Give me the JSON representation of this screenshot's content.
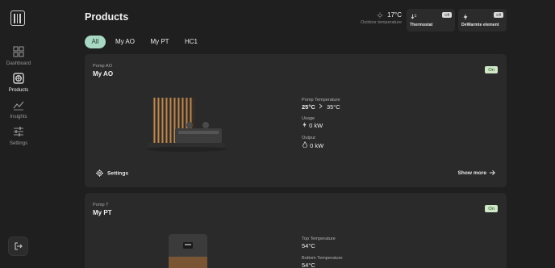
{
  "sidebar": {
    "items": [
      {
        "label": "Dashboard",
        "icon": "grid-icon"
      },
      {
        "label": "Products",
        "icon": "products-icon"
      },
      {
        "label": "Insights",
        "icon": "chart-icon"
      },
      {
        "label": "Settings",
        "icon": "sliders-icon"
      }
    ],
    "active": "Products",
    "logout_icon": "logout-icon"
  },
  "header": {
    "title": "Products",
    "outdoor": {
      "temperature": "17°C",
      "label": "Outdoor temperature"
    },
    "devices": [
      {
        "name": "Thermostat",
        "status": "Off"
      },
      {
        "name": "DeWarmte element",
        "status": "Off"
      }
    ]
  },
  "tabs": [
    {
      "label": "All"
    },
    {
      "label": "My AO"
    },
    {
      "label": "My PT"
    },
    {
      "label": "HC1"
    }
  ],
  "cards": [
    {
      "type": "Pomp AO",
      "name": "My AO",
      "status": "On",
      "metrics": [
        {
          "label": "Pomp Temperature",
          "value": "25°C",
          "target": "35°C"
        },
        {
          "label": "Usage",
          "value": "0 kW"
        },
        {
          "label": "Output",
          "value": "0 kW"
        }
      ],
      "settings_label": "Settings",
      "show_more_label": "Show more"
    },
    {
      "type": "Pomp T",
      "name": "My PT",
      "status": "On",
      "metrics": [
        {
          "label": "Top Temperature",
          "value": "54°C"
        },
        {
          "label": "Bottom Temperature",
          "value": "54°C"
        }
      ]
    }
  ],
  "colors": {
    "background": "#1f1f1f",
    "card": "#2a2a2a",
    "accent": "#a8d8c4",
    "on_badge": "#cfe8c8"
  }
}
